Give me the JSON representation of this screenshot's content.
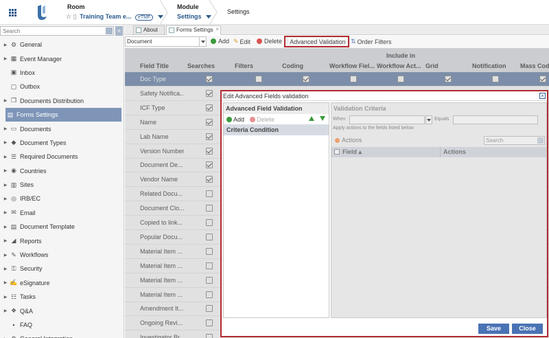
{
  "topbar": {
    "room_title": "Room",
    "room_value": "Training Team e...",
    "room_badge": "eTMF",
    "module_title": "Module",
    "module_value": "Settings",
    "page_title": "Settings"
  },
  "sidebar": {
    "search_placeholder": "Search",
    "collapse_label": "«",
    "items": [
      {
        "label": "General",
        "icon": "gear-icon",
        "arrow": true
      },
      {
        "label": "Event Manager",
        "icon": "calendar-icon",
        "arrow": true
      },
      {
        "label": "Inbox",
        "icon": "inbox-icon",
        "arrow": false
      },
      {
        "label": "Outbox",
        "icon": "outbox-icon",
        "arrow": false
      },
      {
        "label": "Documents Distribution",
        "icon": "documents-icon",
        "arrow": true
      },
      {
        "label": "Forms Settings",
        "icon": "form-icon",
        "arrow": false,
        "active": true
      },
      {
        "label": "Documents",
        "icon": "document-icon",
        "arrow": true
      },
      {
        "label": "Document Types",
        "icon": "tag-icon",
        "arrow": true
      },
      {
        "label": "Required Documents",
        "icon": "list-icon",
        "arrow": true
      },
      {
        "label": "Countries",
        "icon": "globe-icon",
        "arrow": true
      },
      {
        "label": "Sites",
        "icon": "building-icon",
        "arrow": true
      },
      {
        "label": "IRB/EC",
        "icon": "check-circle-icon",
        "arrow": true
      },
      {
        "label": "Email",
        "icon": "email-icon",
        "arrow": true
      },
      {
        "label": "Document Template",
        "icon": "template-icon",
        "arrow": true
      },
      {
        "label": "Reports",
        "icon": "chart-icon",
        "arrow": true
      },
      {
        "label": "Workflows",
        "icon": "pencil-icon",
        "arrow": true
      },
      {
        "label": "Security",
        "icon": "key-icon",
        "arrow": true
      },
      {
        "label": "eSignature",
        "icon": "signature-icon",
        "arrow": true
      },
      {
        "label": "Tasks",
        "icon": "tasks-icon",
        "arrow": true
      },
      {
        "label": "Q&A",
        "icon": "chat-icon",
        "arrow": true
      },
      {
        "label": "FAQ",
        "icon": "faq-icon",
        "arrow": false
      },
      {
        "label": "General Integration",
        "icon": "gear-icon",
        "arrow": true
      }
    ]
  },
  "tabs": [
    {
      "label": "About"
    },
    {
      "label": "Forms Settings",
      "close": "×"
    }
  ],
  "toolbar": {
    "select_value": "Document",
    "add": "Add",
    "edit": "Edit",
    "delete": "Delete",
    "advanced_validation": "Advanced Validation",
    "order_filters": "Order Filters"
  },
  "grid": {
    "group_header": "Include in",
    "columns": [
      "Field Title",
      "Searches",
      "Filters",
      "Coding",
      "Workflow Fiel...",
      "Workflow Act...",
      "Grid",
      "Notification",
      "Mass Codi"
    ],
    "rows": [
      {
        "label": "Doc Type",
        "checked": true,
        "selected": true
      },
      {
        "label": "Safety Notifica...",
        "checked": true
      },
      {
        "label": "ICF Type",
        "checked": true
      },
      {
        "label": "Name",
        "checked": true
      },
      {
        "label": "Lab Name",
        "checked": true
      },
      {
        "label": "Version Number",
        "checked": true
      },
      {
        "label": "Document De...",
        "checked": true
      },
      {
        "label": "Vendor Name",
        "checked": true
      },
      {
        "label": "Related Docu...",
        "checked": false
      },
      {
        "label": "Document Clo...",
        "checked": false
      },
      {
        "label": "Copied to link...",
        "checked": false
      },
      {
        "label": "Popular Docu...",
        "checked": false
      },
      {
        "label": "Material Item ...",
        "checked": false
      },
      {
        "label": "Material Item ...",
        "checked": false
      },
      {
        "label": "Material Item ...",
        "checked": false
      },
      {
        "label": "Material Item ...",
        "checked": false
      },
      {
        "label": "Amendment It...",
        "checked": false
      },
      {
        "label": "Ongoing Revi...",
        "checked": false
      },
      {
        "label": "Investigator Br...",
        "checked": false
      }
    ]
  },
  "dialog": {
    "title": "Edit Advanced Fields validation",
    "close": "×",
    "left_header": "Advanced Field Validation",
    "add": "Add",
    "delete": "Delete",
    "criteria_header": "Criteria Condition",
    "right_header": "Validation Criteria",
    "when_label": "When",
    "equals_label": "Equals",
    "apply_text": "Apply actions to the fields listed below",
    "actions_label": "Actions",
    "search_placeholder": "Search",
    "col_field": "Field",
    "col_actions": "Actions",
    "save": "Save",
    "close_btn": "Close"
  }
}
